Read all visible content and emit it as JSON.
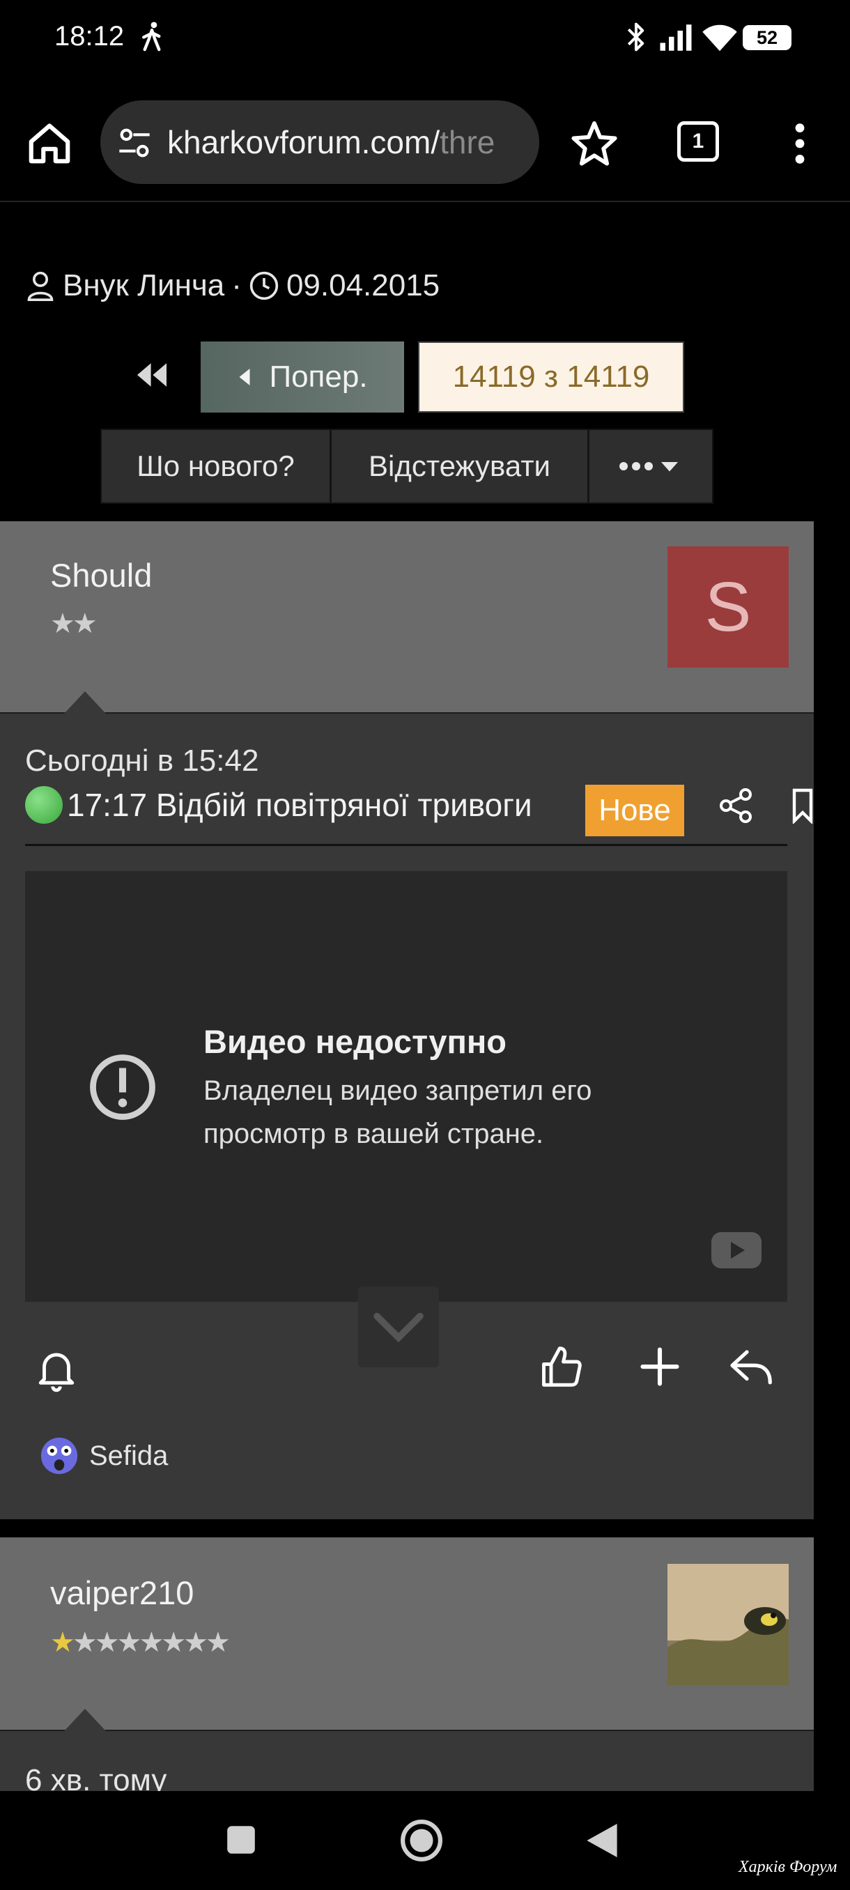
{
  "status_bar": {
    "time": "18:12",
    "battery": "52"
  },
  "browser": {
    "url_main": "kharkovforum.com/",
    "url_dim": "thre",
    "tab_count": "1"
  },
  "thread": {
    "author": "Внук Линча",
    "date": "09.04.2015",
    "prev_label": "Попер.",
    "page_current": "14119 з 14119",
    "actions": [
      "Шо нового?",
      "Відстежувати"
    ]
  },
  "post1": {
    "username": "Should",
    "rank_stars": "★★",
    "avatar_letter": "S",
    "time": "Сьогодні в 15:42",
    "text": "17:17 Відбій повітряної тривоги",
    "badge": "Нове",
    "video_title": "Видео недоступно",
    "video_message": "Владелец видео запретил его просмотр в вашей стране.",
    "reaction_user": "Sefida"
  },
  "post2": {
    "username": "vaiper210",
    "rank_stars": "★★★★★★★",
    "time": "6 хв. тому"
  },
  "watermark": "Харків Форум",
  "colors": {
    "badge": "#f0a030",
    "avatar_s": "#9a3c3c",
    "post_header": "#6b6b6b",
    "post_body": "#383838"
  }
}
